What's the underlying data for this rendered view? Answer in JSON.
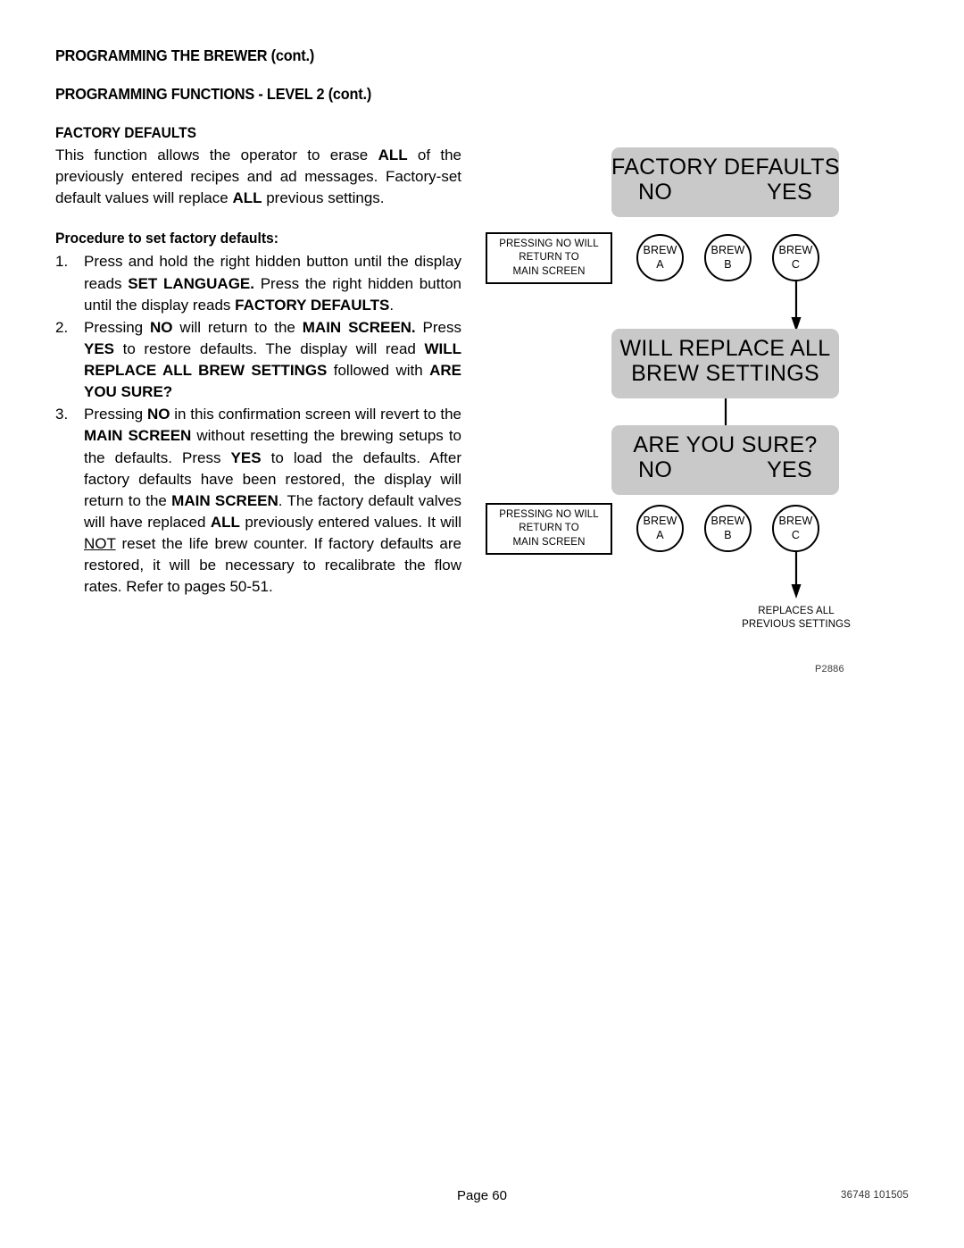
{
  "headings": {
    "h1": "PROGRAMMING THE BREWER (cont.)",
    "h2": "PROGRAMMING FUNCTIONS - LEVEL  2 (cont.)",
    "section_title": "FACTORY DEFAULTS",
    "procedure_title": "Procedure to set factory defaults:"
  },
  "intro": {
    "part1": "This function allows the operator to erase ",
    "bold1": "ALL",
    "part2": " of the previously entered recipes and ad messages. Factory-set default values will replace ",
    "bold2": "ALL",
    "part3": " previous settings."
  },
  "steps": [
    {
      "number": "1.",
      "segments": [
        {
          "text": "Press and hold the right hidden button until the display reads ",
          "bold": false
        },
        {
          "text": "SET LANGUAGE.",
          "bold": true
        },
        {
          "text": " Press the right hidden button until the display reads ",
          "bold": false
        },
        {
          "text": "FACTORY DEFAULTS",
          "bold": true
        },
        {
          "text": ".",
          "bold": false
        }
      ]
    },
    {
      "number": "2.",
      "segments": [
        {
          "text": "Pressing ",
          "bold": false
        },
        {
          "text": "NO",
          "bold": true
        },
        {
          "text": " will return to the ",
          "bold": false
        },
        {
          "text": "MAIN SCREEN.",
          "bold": true
        },
        {
          "text": " Press ",
          "bold": false
        },
        {
          "text": "YES",
          "bold": true
        },
        {
          "text": " to restore defaults. The display will read ",
          "bold": false
        },
        {
          "text": "WILL REPLACE ALL BREW SETTINGS",
          "bold": true
        },
        {
          "text": " followed with ",
          "bold": false
        },
        {
          "text": "ARE YOU SURE?",
          "bold": true
        }
      ]
    },
    {
      "number": "3.",
      "segments": [
        {
          "text": "Pressing ",
          "bold": false
        },
        {
          "text": "NO",
          "bold": true
        },
        {
          "text": " in this confirmation screen will revert to the ",
          "bold": false
        },
        {
          "text": "MAIN SCREEN",
          "bold": true
        },
        {
          "text": " without resetting the brewing setups to the defaults. Press ",
          "bold": false
        },
        {
          "text": "YES",
          "bold": true
        },
        {
          "text": " to load the defaults. After factory defaults have been restored, the display will return to the ",
          "bold": false
        },
        {
          "text": "MAIN SCREEN",
          "bold": true
        },
        {
          "text": ". The factory default valves will have replaced ",
          "bold": false
        },
        {
          "text": "ALL",
          "bold": true
        },
        {
          "text": " previously entered values. It will ",
          "bold": false
        },
        {
          "text": "NOT",
          "bold": false,
          "underline": true
        },
        {
          "text": " reset the life brew counter. If factory defaults are restored, it will be necessary to recalibrate the flow rates.  Refer to pages 50-51.",
          "bold": false
        }
      ]
    }
  ],
  "diagram": {
    "screen1": {
      "title": "FACTORY DEFAULTS",
      "no": "NO",
      "yes": "YES"
    },
    "screen2": {
      "line1": "WILL REPLACE ALL",
      "line2": "BREW SETTINGS"
    },
    "screen3": {
      "title": "ARE YOU SURE?",
      "no": "NO",
      "yes": "YES"
    },
    "note1": {
      "line1": "PRESSING NO WILL",
      "line2": "RETURN TO",
      "line3": "MAIN SCREEN"
    },
    "note2": {
      "line1": "PRESSING NO WILL",
      "line2": "RETURN TO",
      "line3": "MAIN SCREEN"
    },
    "brew_buttons_top": [
      {
        "line1": "BREW",
        "line2": "A"
      },
      {
        "line1": "BREW",
        "line2": "B"
      },
      {
        "line1": "BREW",
        "line2": "C"
      }
    ],
    "brew_buttons_bottom": [
      {
        "line1": "BREW",
        "line2": "A"
      },
      {
        "line1": "BREW",
        "line2": "B"
      },
      {
        "line1": "BREW",
        "line2": "C"
      }
    ],
    "result_caption": "REPLACES ALL\nPREVIOUS SETTINGS",
    "figure_id": "P2886",
    "lcd_color": "#c9c9c9"
  },
  "footer": {
    "page_label": "Page 60",
    "doc_code": "36748 101505"
  }
}
